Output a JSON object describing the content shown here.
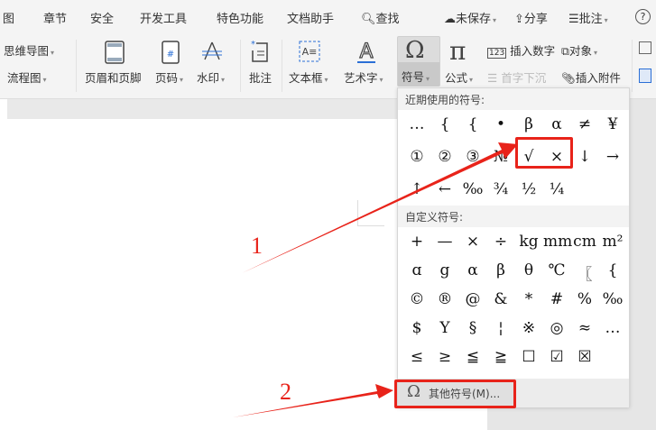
{
  "tabs": [
    "图",
    "章节",
    "安全",
    "开发工具",
    "特色功能",
    "文档助手",
    "查找"
  ],
  "top_right": {
    "unsaved": "未保存",
    "share": "分享",
    "comment": "批注",
    "help": "?"
  },
  "ribbon": {
    "mindmap": "思维导图",
    "flowchart": "流程图",
    "header_footer": "页眉和页脚",
    "page_number": "页码",
    "watermark": "水印",
    "comment": "批注",
    "textbox": "文本框",
    "wordart": "艺术字",
    "symbol": "符号",
    "formula": "公式",
    "insert_number": "插入数字",
    "object": "对象",
    "drop_cap": "首字下沉",
    "attachment": "插入附件"
  },
  "popup": {
    "recent_title": "近期使用的符号:",
    "recent": [
      [
        "…",
        "{",
        "{",
        "•",
        "β",
        "α",
        "≠",
        "¥"
      ],
      [
        "①",
        "②",
        "③",
        "№",
        "√",
        "×",
        "↓",
        "→"
      ],
      [
        "↑",
        "←",
        "‰",
        "¾",
        "½",
        "¼"
      ]
    ],
    "custom_title": "自定义符号:",
    "custom": [
      [
        "+",
        "—",
        "×",
        "÷",
        "kg",
        "mm",
        "cm",
        "m²"
      ],
      [
        "ɑ",
        "g",
        "α",
        "β",
        "θ",
        "℃",
        "〖",
        "{"
      ],
      [
        "©",
        "®",
        "@",
        "&",
        "*",
        "#",
        "%",
        "‰"
      ],
      [
        "$",
        "Y",
        "§",
        "¦",
        "※",
        "◎",
        "≈",
        "…"
      ],
      [
        "≤",
        "≥",
        "≦",
        "≧",
        "☐",
        "☑",
        "☒"
      ]
    ],
    "more": "其他符号(M)..."
  },
  "annotations": {
    "step1": "1",
    "step2": "2"
  },
  "colors": {
    "annotation": "#e8231a",
    "accent": "#2b6fd6"
  }
}
